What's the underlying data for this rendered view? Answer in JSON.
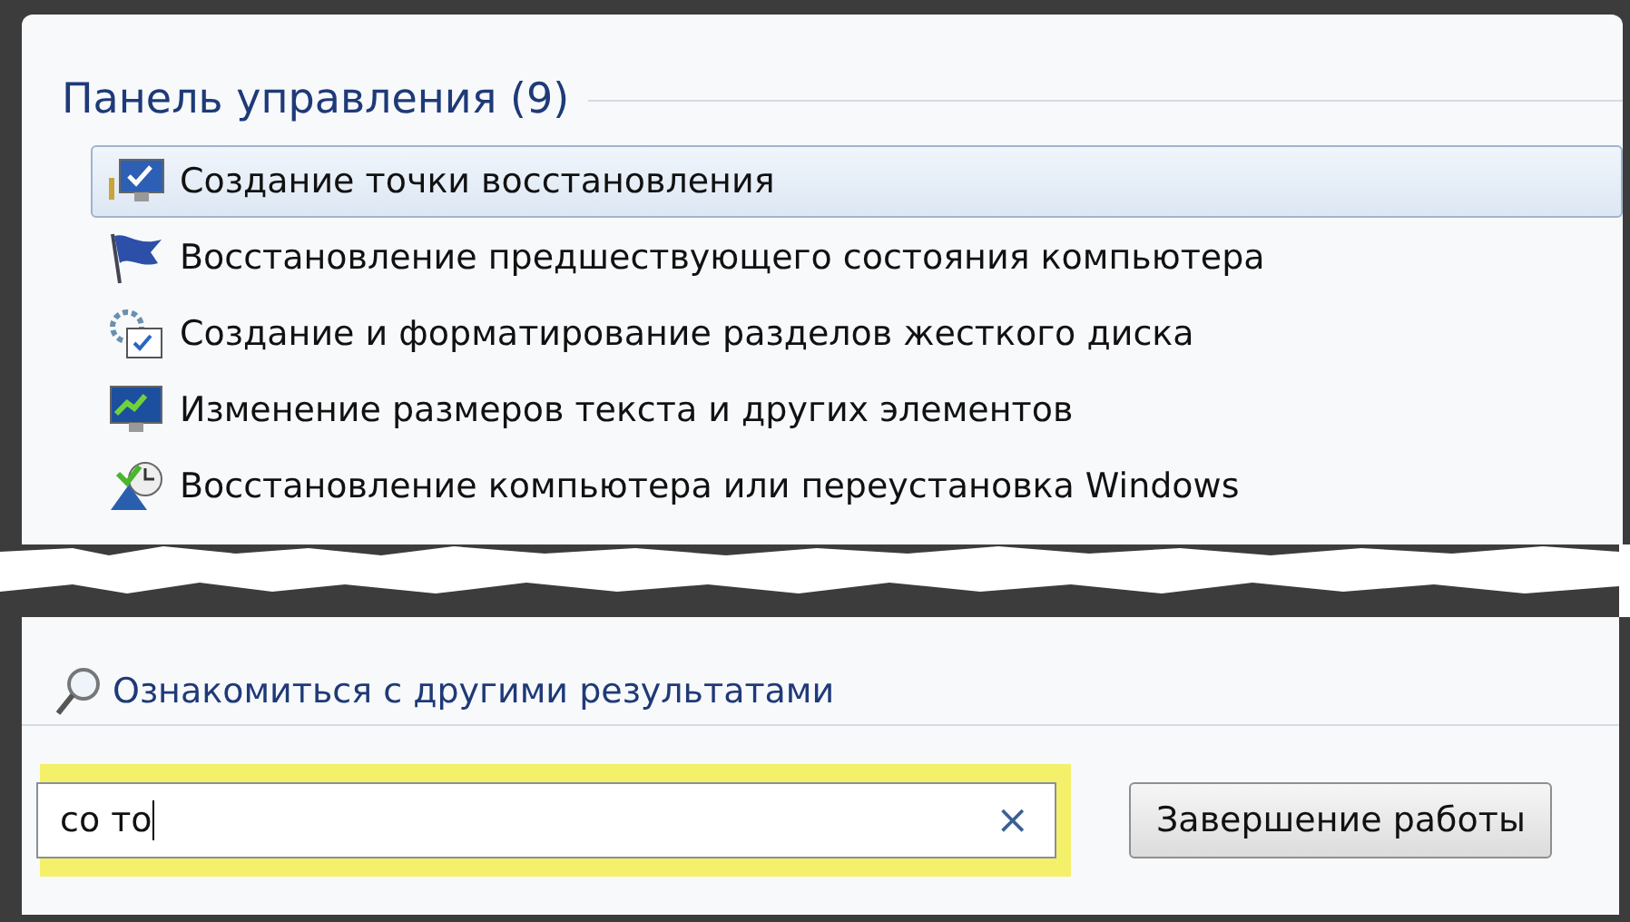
{
  "results_group": {
    "title": "Панель управления (9)",
    "items": [
      {
        "label": "Создание точки восстановления",
        "kind": "restore-point",
        "selected": true
      },
      {
        "label": "Восстановление предшествующего состояния компьютера",
        "kind": "rollback",
        "selected": false
      },
      {
        "label": "Создание и форматирование разделов жесткого диска",
        "kind": "partition",
        "selected": false
      },
      {
        "label": "Изменение размеров текста и других элементов",
        "kind": "display",
        "selected": false
      },
      {
        "label": "Восстановление компьютера или переустановка Windows",
        "kind": "recovery",
        "selected": false
      }
    ]
  },
  "more_results": "Ознакомиться с другими результатами",
  "search": {
    "value": "со то",
    "clear": "×",
    "highlighted": true
  },
  "shutdown_button": "Завершение работы"
}
